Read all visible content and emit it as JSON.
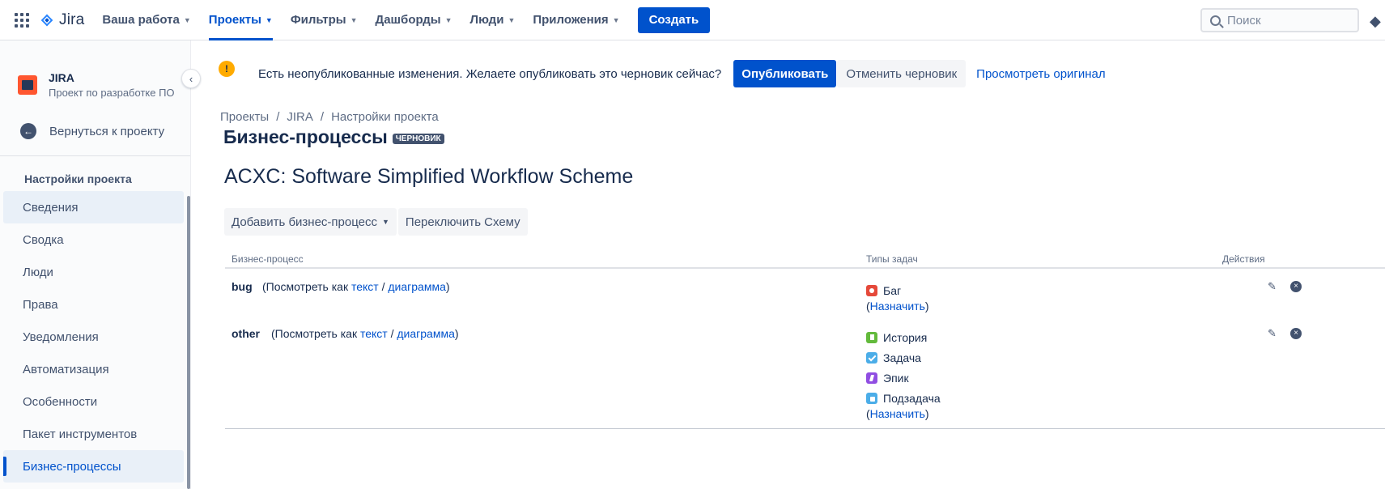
{
  "nav": {
    "logo_text": "Jira",
    "items": [
      {
        "label": "Ваша работа"
      },
      {
        "label": "Проекты"
      },
      {
        "label": "Фильтры"
      },
      {
        "label": "Дашборды"
      },
      {
        "label": "Люди"
      },
      {
        "label": "Приложения"
      }
    ],
    "active_item": "Проекты",
    "create_label": "Создать",
    "search_placeholder": "Поиск"
  },
  "sidebar": {
    "project_name": "JIRA",
    "project_type": "Проект по разработке ПО",
    "back_label": "Вернуться к проекту",
    "section_title": "Настройки проекта",
    "items": [
      {
        "label": "Сведения"
      },
      {
        "label": "Сводка"
      },
      {
        "label": "Люди"
      },
      {
        "label": "Права"
      },
      {
        "label": "Уведомления"
      },
      {
        "label": "Автоматизация"
      },
      {
        "label": "Особенности"
      },
      {
        "label": "Пакет инструментов"
      },
      {
        "label": "Бизнес-процессы"
      }
    ],
    "current_item": "Бизнес-процессы"
  },
  "banner": {
    "message": "Есть неопубликованные изменения. Желаете опубликовать это черновик сейчас?",
    "publish_label": "Опубликовать",
    "discard_label": "Отменить черновик",
    "view_original_label": "Просмотреть оригинал"
  },
  "breadcrumbs": [
    "Проекты",
    "JIRA",
    "Настройки проекта"
  ],
  "page": {
    "title": "Бизнес-процессы",
    "badge": "ЧЕРНОВИК",
    "scheme_name": "ACXC: Software Simplified Workflow Scheme",
    "add_workflow_label": "Добавить бизнес-процесс",
    "switch_scheme_label": "Переключить Схему"
  },
  "table": {
    "columns": {
      "workflow": "Бизнес-процесс",
      "issue_types": "Типы задач",
      "actions": "Действия"
    },
    "view_prefix": "(Посмотреть как",
    "view_text": "текст",
    "view_slash": "/",
    "view_diagram": "диаграмма",
    "view_suffix": ")",
    "assign_open": "(",
    "assign_label": "Назначить",
    "assign_close": ")",
    "rows": [
      {
        "name": "bug",
        "issue_types": [
          {
            "label": "Баг",
            "icon": "bug-icon"
          }
        ]
      },
      {
        "name": "other",
        "issue_types": [
          {
            "label": "История",
            "icon": "story-icon"
          },
          {
            "label": "Задача",
            "icon": "task-icon"
          },
          {
            "label": "Эпик",
            "icon": "epic-icon"
          },
          {
            "label": "Подзадача",
            "icon": "subtask-icon"
          }
        ]
      }
    ]
  },
  "colors": {
    "primary": "#0052cc",
    "text": "#172b4d",
    "subtle_text": "#42526e",
    "warning": "#ffab00",
    "bug": "#e5493a",
    "story": "#63ba3c",
    "task": "#4bade8",
    "epic": "#904ee2"
  }
}
